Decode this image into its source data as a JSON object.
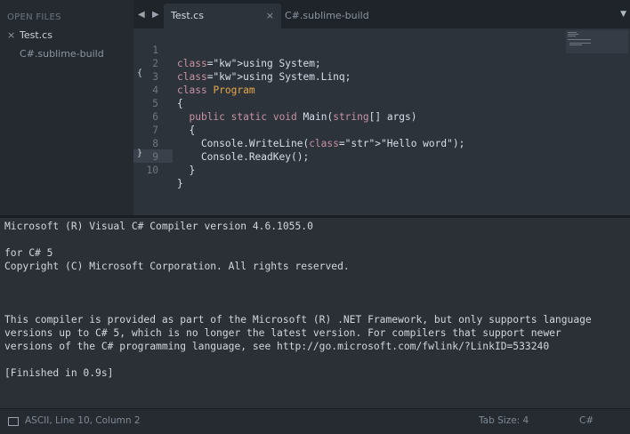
{
  "sidebar": {
    "header": "OPEN FILES",
    "files": [
      {
        "label": "Test.cs",
        "close": "×"
      },
      {
        "label": "C#.sublime-build"
      }
    ]
  },
  "tabs": {
    "back": "◀",
    "forward": "▶",
    "items": [
      {
        "label": "Test.cs",
        "close": "×"
      },
      {
        "label": "C#.sublime-build"
      }
    ],
    "menu": "▼"
  },
  "editor": {
    "lines": [
      {
        "num": "1",
        "text": "using System;"
      },
      {
        "num": "2",
        "text": "using System.Linq;"
      },
      {
        "num": "3",
        "text": "class Program"
      },
      {
        "num": "4",
        "text": "{"
      },
      {
        "num": "5",
        "text": "  public static void Main(string[] args)"
      },
      {
        "num": "6",
        "text": "  {"
      },
      {
        "num": "7",
        "text": "    Console.WriteLine(\"Hello word\");"
      },
      {
        "num": "8",
        "text": "    Console.ReadKey();"
      },
      {
        "num": "9",
        "text": "  }"
      },
      {
        "num": "10",
        "text": "}"
      }
    ],
    "fold_open": "{",
    "fold_close": "}"
  },
  "output": {
    "lines": [
      "Microsoft (R) Visual C# Compiler version 4.6.1055.0",
      "",
      "for C# 5",
      "Copyright (C) Microsoft Corporation. All rights reserved.",
      "",
      "",
      "",
      "This compiler is provided as part of the Microsoft (R) .NET Framework, but only supports language",
      "versions up to C# 5, which is no longer the latest version. For compilers that support newer",
      "versions of the C# programming language, see http://go.microsoft.com/fwlink/?LinkID=533240",
      "",
      "[Finished in 0.9s]"
    ]
  },
  "status": {
    "position": "ASCII, Line 10, Column 2",
    "tab_size": "Tab Size: 4",
    "syntax": "C#"
  }
}
